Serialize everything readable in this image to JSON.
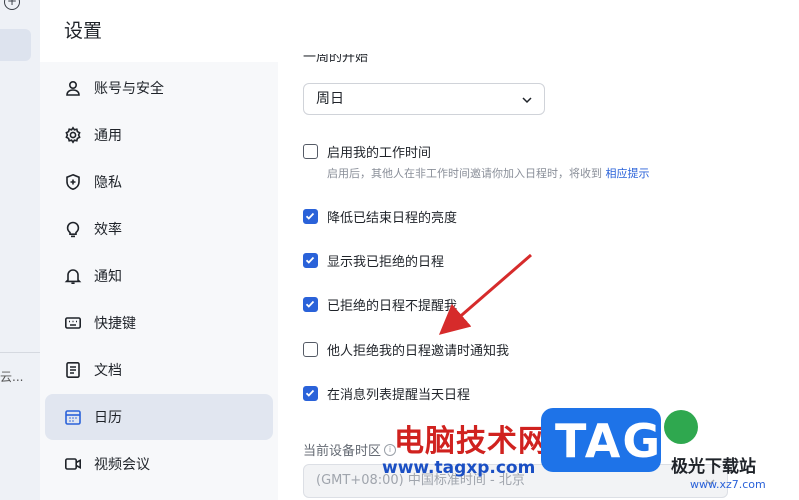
{
  "app": {
    "title": "设置"
  },
  "left_strip": {
    "plus_glyph": "+",
    "text": "云..."
  },
  "nav": {
    "items": [
      {
        "label": "账号与安全",
        "icon": "person-icon",
        "active": false
      },
      {
        "label": "通用",
        "icon": "gear-icon",
        "active": false
      },
      {
        "label": "隐私",
        "icon": "shield-icon",
        "active": false
      },
      {
        "label": "效率",
        "icon": "lightbulb-icon",
        "active": false
      },
      {
        "label": "通知",
        "icon": "bell-icon",
        "active": false
      },
      {
        "label": "快捷键",
        "icon": "keyboard-icon",
        "active": false
      },
      {
        "label": "文档",
        "icon": "document-icon",
        "active": false
      },
      {
        "label": "日历",
        "icon": "calendar-icon",
        "active": true
      },
      {
        "label": "视频会议",
        "icon": "video-icon",
        "active": false
      }
    ]
  },
  "calendar": {
    "week_start": {
      "partial_label": "一周的开始",
      "value": "周日"
    },
    "options": [
      {
        "label": "启用我的工作时间",
        "checked": false
      },
      {
        "label": "降低已结束日程的亮度",
        "checked": true
      },
      {
        "label": "显示我已拒绝的日程",
        "checked": true
      },
      {
        "label": "已拒绝的日程不提醒我",
        "checked": true
      },
      {
        "label": "他人拒绝我的日程邀请时通知我",
        "checked": false
      },
      {
        "label": "在消息列表提醒当天日程",
        "checked": true
      }
    ],
    "work_hint": {
      "text": "启用后，其他人在非工作时间邀请你加入日程时，将收到",
      "link": "相应提示"
    },
    "device_tz": {
      "label": "当前设备时区",
      "value": "(GMT+08:00) 中国标准时间 - 北京"
    }
  },
  "watermark": {
    "cn_text": "电脑技术网",
    "url": "www.tagxp.com",
    "tag": "TAG",
    "logo_text": "极光下载站",
    "logo_url": "www.xz7.com"
  },
  "colors": {
    "accent": "#2a62d9",
    "active_nav_bg": "#e1e6f0",
    "arrow": "#d62b2b"
  }
}
